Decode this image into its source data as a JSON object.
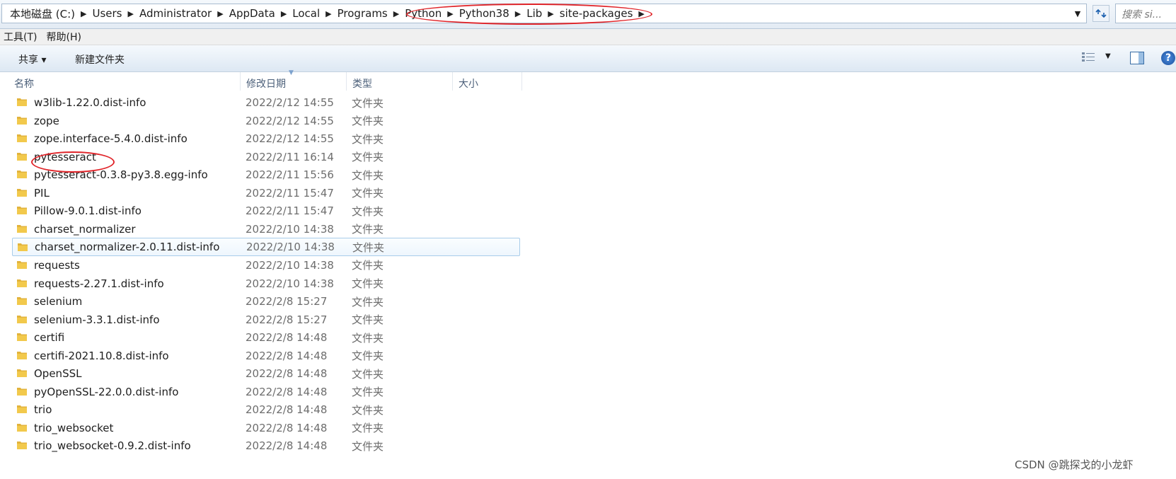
{
  "address_bar": {
    "crumbs": [
      "本地磁盘 (C:)",
      "Users",
      "Administrator",
      "AppData",
      "Local",
      "Programs",
      "Python",
      "Python38",
      "Lib",
      "site-packages"
    ],
    "search_placeholder": "搜索 si..."
  },
  "menu": {
    "items": [
      "工具(T)",
      "帮助(H)"
    ]
  },
  "toolbar": {
    "share_label": "共享 ▾",
    "new_folder_label": "新建文件夹",
    "help_glyph": "?"
  },
  "columns": [
    "名称",
    "修改日期",
    "类型",
    "大小"
  ],
  "rows": [
    {
      "name": "w3lib-1.22.0.dist-info",
      "date": "2022/2/12 14:55",
      "type": "文件夹"
    },
    {
      "name": "zope",
      "date": "2022/2/12 14:55",
      "type": "文件夹"
    },
    {
      "name": "zope.interface-5.4.0.dist-info",
      "date": "2022/2/12 14:55",
      "type": "文件夹"
    },
    {
      "name": "pytesseract",
      "date": "2022/2/11 16:14",
      "type": "文件夹"
    },
    {
      "name": "pytesseract-0.3.8-py3.8.egg-info",
      "date": "2022/2/11 15:56",
      "type": "文件夹"
    },
    {
      "name": "PIL",
      "date": "2022/2/11 15:47",
      "type": "文件夹"
    },
    {
      "name": "Pillow-9.0.1.dist-info",
      "date": "2022/2/11 15:47",
      "type": "文件夹"
    },
    {
      "name": "charset_normalizer",
      "date": "2022/2/10 14:38",
      "type": "文件夹"
    },
    {
      "name": "charset_normalizer-2.0.11.dist-info",
      "date": "2022/2/10 14:38",
      "type": "文件夹"
    },
    {
      "name": "requests",
      "date": "2022/2/10 14:38",
      "type": "文件夹"
    },
    {
      "name": "requests-2.27.1.dist-info",
      "date": "2022/2/10 14:38",
      "type": "文件夹"
    },
    {
      "name": "selenium",
      "date": "2022/2/8 15:27",
      "type": "文件夹"
    },
    {
      "name": "selenium-3.3.1.dist-info",
      "date": "2022/2/8 15:27",
      "type": "文件夹"
    },
    {
      "name": "certifi",
      "date": "2022/2/8 14:48",
      "type": "文件夹"
    },
    {
      "name": "certifi-2021.10.8.dist-info",
      "date": "2022/2/8 14:48",
      "type": "文件夹"
    },
    {
      "name": "OpenSSL",
      "date": "2022/2/8 14:48",
      "type": "文件夹"
    },
    {
      "name": "pyOpenSSL-22.0.0.dist-info",
      "date": "2022/2/8 14:48",
      "type": "文件夹"
    },
    {
      "name": "trio",
      "date": "2022/2/8 14:48",
      "type": "文件夹"
    },
    {
      "name": "trio_websocket",
      "date": "2022/2/8 14:48",
      "type": "文件夹"
    },
    {
      "name": "trio_websocket-0.9.2.dist-info",
      "date": "2022/2/8 14:48",
      "type": "文件夹"
    }
  ],
  "selected_row_index": 8,
  "watermark": "CSDN @跳探戈的小龙虾",
  "colors": {
    "annotation": "#e0252a",
    "folder": "#f2c94c",
    "selection_border": "#a9cdea"
  }
}
